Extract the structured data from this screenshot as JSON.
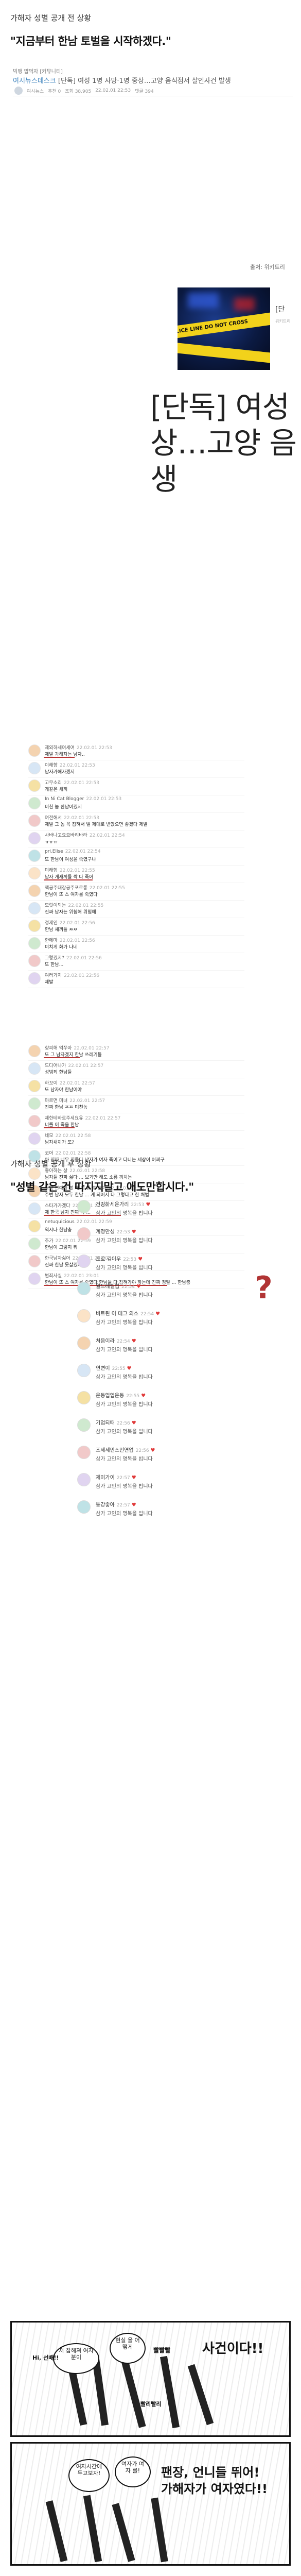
{
  "section1": {
    "heading": "가해자 성별 공개 전 상황",
    "quote": "\"지금부터 한남 토벌을 시작하겠다.\""
  },
  "post": {
    "cafe": "빅뱅 밥먹자 [커뮤니티]",
    "source": "여시뉴스데스크",
    "title": "[단독] 여성 1명 사망·1명 중상…고양 음식점서 살인사건 발생",
    "meta": [
      "여시뉴스",
      "추천 0",
      "조회 38,905",
      "22.02.01 22:53",
      "댓글 394"
    ]
  },
  "link_card": {
    "label": "출처: 위키트리",
    "thumb_band": "POLICE LINE DO NOT CROSS",
    "side_title": "[단",
    "side_sub": "위키트리",
    "big_title": "[단독] 여성\n상…고양 음\n생"
  },
  "comments_a": [
    {
      "nick": "제외하세여세여",
      "time": "22.02.01 22:53",
      "text": "제발 가해자는 남자..",
      "ul": 60
    },
    {
      "nick": "이해함",
      "time": "22.02.01 22:53",
      "text": "남자가해자겠지",
      "ul": 0
    },
    {
      "nick": "고무소리",
      "time": "22.02.01 22:53",
      "text": "개같은 새끼",
      "ul": 0
    },
    {
      "nick": "In Ni Cat Blogger",
      "time": "22.02.01 22:53",
      "text": "미친 놈 한남이겠지",
      "ul": 0
    },
    {
      "nick": "여전해서",
      "time": "22.02.01 22:53",
      "text": "제발 그 놈 꼭 잡혀서 벌 제대로 받았으면 좋겠다 제발",
      "ul": 0
    },
    {
      "nick": "사바나고요요바리바라",
      "time": "22.02.01 22:54",
      "text": "ㅠㅠㅠ",
      "ul": 0
    },
    {
      "nick": "pri.Elise",
      "time": "22.02.01 22:54",
      "text": "또 한남이 여성을 죽였구나",
      "ul": 0
    },
    {
      "nick": "미래형",
      "time": "22.02.01 22:55",
      "text": "남자 개새끼들 싹 다 죽어",
      "ul": 95
    },
    {
      "nick": "핵공주대장공주포로롱",
      "time": "22.02.01 22:55",
      "text": "한남이 또 스 여자를 죽였다",
      "ul": 0
    },
    {
      "nick": "모릿이되는",
      "time": "22.02.01 22:55",
      "text": "진짜 남자는 위험해 위험해",
      "ul": 0
    },
    {
      "nick": "경제인",
      "time": "22.02.01 22:56",
      "text": "한남 새끼들 ㅉㅉ",
      "ul": 0
    },
    {
      "nick": "한메마",
      "time": "22.02.01 22:56",
      "text": "미치게 화가 나네",
      "ul": 0
    },
    {
      "nick": "그렇겠지?",
      "time": "22.02.01 22:56",
      "text": "또 한남...",
      "ul": 0
    },
    {
      "nick": "여러가지",
      "time": "22.02.01 22:56",
      "text": "제발",
      "ul": 0
    }
  ],
  "comments_b": [
    {
      "nick": "향피해 억쭈아",
      "time": "22.02.01 22:57",
      "text": "또 그 남자겠지 한남 쓰레기들",
      "ul": 70
    },
    {
      "nick": "드디어나가",
      "time": "22.02.01 22:57",
      "text": "성범죄 한남들",
      "ul": 0
    },
    {
      "nick": "하꼬이",
      "time": "22.02.01 22:57",
      "text": "또 남자야 한남이야",
      "ul": 0
    },
    {
      "nick": "마르면 미녀",
      "time": "22.02.01 22:57",
      "text": "진짜 한남 ㅉㅉ 미친놈",
      "ul": 0
    },
    {
      "nick": "제한테바로주세요유",
      "time": "22.02.01 22:57",
      "text": "너를 이 죽을 한남",
      "ul": 60
    },
    {
      "nick": "네모",
      "time": "22.02.01 22:58",
      "text": "남자새끼가 또?",
      "ul": 0
    },
    {
      "nick": "코어",
      "time": "22.02.01 22:58",
      "text": "아 진짜 너무 힘들다 남자가 여자 죽이고 다니는 세상이 어쩌구",
      "ul": 0
    },
    {
      "nick": "좋아하는 상",
      "time": "22.02.01 22:58",
      "text": "남자들 진짜 싫다 ... 보기만 해도 소름 끼치는",
      "ul": 0
    },
    {
      "nick": "동방 연예를 볼 때 치 환 후 효과",
      "time": "22.02.01 22:58",
      "text": "주변 남자 모두 한남 ... 게 되어서 다 그렇다고 한 처벌",
      "ul": 0
    },
    {
      "nick": "스타가가겠다",
      "time": "22.02.01 22:59",
      "text": "제 한국 남자 진짜 다 ...",
      "ul": 150
    },
    {
      "nick": "netuquicious",
      "time": "22.02.01 22:59",
      "text": "역시나 한남충",
      "ul": 0
    },
    {
      "nick": "추가",
      "time": "22.02.01 22:59",
      "text": "한남이 그렇지 뭐",
      "ul": 0
    },
    {
      "nick": "한국남자싫어",
      "time": "22.02.01 23:00",
      "text": "진짜 한남 못살겠다",
      "ul": 0
    },
    {
      "nick": "범죄사실",
      "time": "22.02.01 23:01",
      "text": "한남이 또 스 여자를 죽였다 한남들 다 잡혀가야 하는데 진짜 정말 ... 한남충",
      "ul": 240
    }
  ],
  "section2": {
    "heading": "가해자 성별 공개 후 상황",
    "quote": "\"성별 같은 건 따지지말고 애도만합시다.\"",
    "question_mark": "?"
  },
  "comments_c": [
    {
      "nick": "건강하세운가리",
      "time": "22:53",
      "text": "삼가 고인의 명복을 빕니다"
    },
    {
      "nick": "계정만성",
      "time": "22:53",
      "text": "삼가 고인의 명복을 빕니다"
    },
    {
      "nick": "포로 깊이우",
      "time": "22:53",
      "text": "삼가 고인의 명복을 빕니다"
    },
    {
      "nick": "월드레렐럽",
      "time": "22:54",
      "text": "삼가 고인의 명복을 빕니다"
    },
    {
      "nick": "비트된 이 데그 의소",
      "time": "22:54",
      "text": "삼가 고인의 명복을 빕니다"
    },
    {
      "nick": "처음이라",
      "time": "22:54",
      "text": "삼가 고인의 명복을 빕니다"
    },
    {
      "nick": "연변이",
      "time": "22:55",
      "text": "삼가 고인의 명복을 빕니다"
    },
    {
      "nick": "운동업업운동",
      "time": "22:55",
      "text": "삼가 고인의 명복을 빕니다"
    },
    {
      "nick": "기업되때",
      "time": "22:56",
      "text": "삼가 고인의 명복을 빕니다"
    },
    {
      "nick": "조세세민스민연업",
      "time": "22:56",
      "text": "삼가 고인의 명복을 빕니다"
    },
    {
      "nick": "제미가이",
      "time": "22:57",
      "text": "삼가 고인의 명복을 빕니다"
    },
    {
      "nick": "통강좋아",
      "time": "22:57",
      "text": "삼가 고인의 명복을 빕니다"
    }
  ],
  "manga": {
    "p1_shout": "사건이다!!",
    "p1_b1": "저 잡해져 여자분이",
    "p1_b2": "빨리빨리",
    "p1_b3": "현실 을 어떻게",
    "p1_b4": "빨빨빨",
    "p1_small": "Hi, 선배!!",
    "p2_shout": "팬장, 언니들 뛰어!\n가해자가 여자였다!!",
    "p2_b1": "여자시간에 두고보자!",
    "p2_b2": "여자가 여자 를!"
  }
}
